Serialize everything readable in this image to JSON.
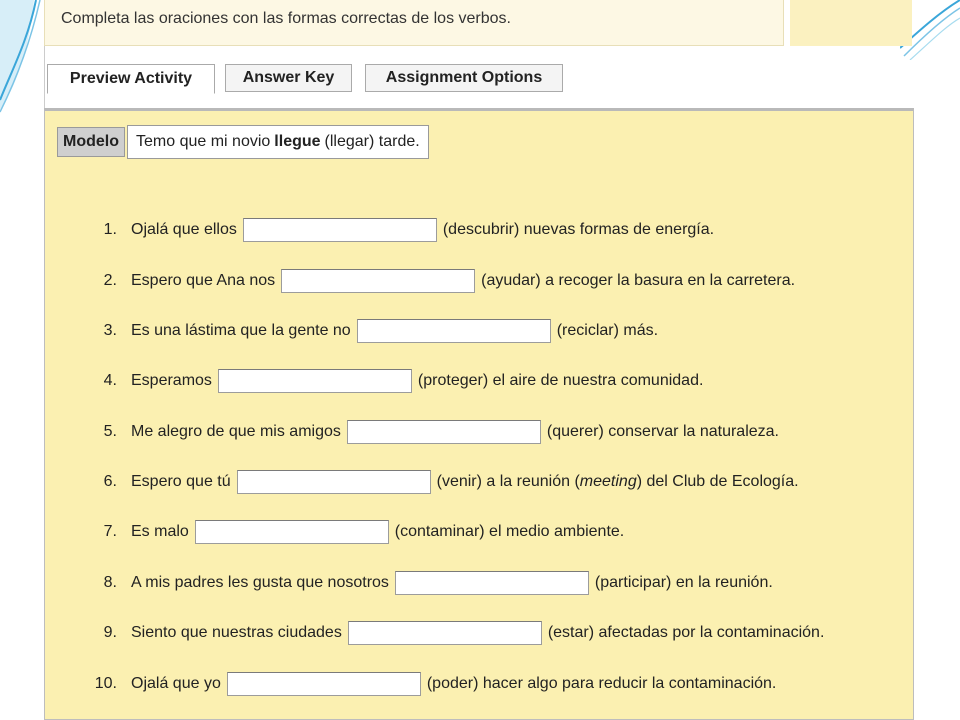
{
  "instruction": "Completa las oraciones con las formas correctas de los verbos.",
  "tabs": [
    {
      "label": "Preview Activity",
      "active": true
    },
    {
      "label": "Answer Key",
      "active": false
    },
    {
      "label": "Assignment Options",
      "active": false
    }
  ],
  "modelo": {
    "label": "Modelo",
    "before": "Temo que mi novio",
    "verb": "llegue",
    "after": "(llegar) tarde."
  },
  "items": [
    {
      "num": "1.",
      "before": "Ojalá que ellos",
      "after": "(descubrir) nuevas formas de energía.",
      "value": ""
    },
    {
      "num": "2.",
      "before": "Espero que Ana nos",
      "after": "(ayudar) a recoger la basura en la carretera.",
      "value": ""
    },
    {
      "num": "3.",
      "before": "Es una lástima que la gente no",
      "after": "(reciclar) más.",
      "value": ""
    },
    {
      "num": "4.",
      "before": "Esperamos",
      "after": "(proteger) el aire de nuestra comunidad.",
      "value": ""
    },
    {
      "num": "5.",
      "before": "Me alegro de que mis amigos",
      "after": "(querer) conservar la naturaleza.",
      "value": ""
    },
    {
      "num": "6.",
      "before": "Espero que tú",
      "after_pre": "(venir) a la reunión (",
      "after_italic": "meeting",
      "after_post": ") del Club de Ecología.",
      "value": ""
    },
    {
      "num": "7.",
      "before": "Es malo",
      "after": "(contaminar) el medio ambiente.",
      "value": ""
    },
    {
      "num": "8.",
      "before": "A mis padres les gusta que nosotros",
      "after": "(participar) en la reunión.",
      "value": ""
    },
    {
      "num": "9.",
      "before": "Siento que nuestras ciudades",
      "after": "(estar) afectadas por la contaminación.",
      "value": ""
    },
    {
      "num": "10.",
      "before": "Ojalá que yo",
      "after": "(poder) hacer algo para reducir la contaminación.",
      "value": ""
    }
  ],
  "colors": {
    "content_bg": "#fbf0b1",
    "instruction_bg": "#fdf8e4",
    "accent_swoosh": "#3aa6d9"
  }
}
